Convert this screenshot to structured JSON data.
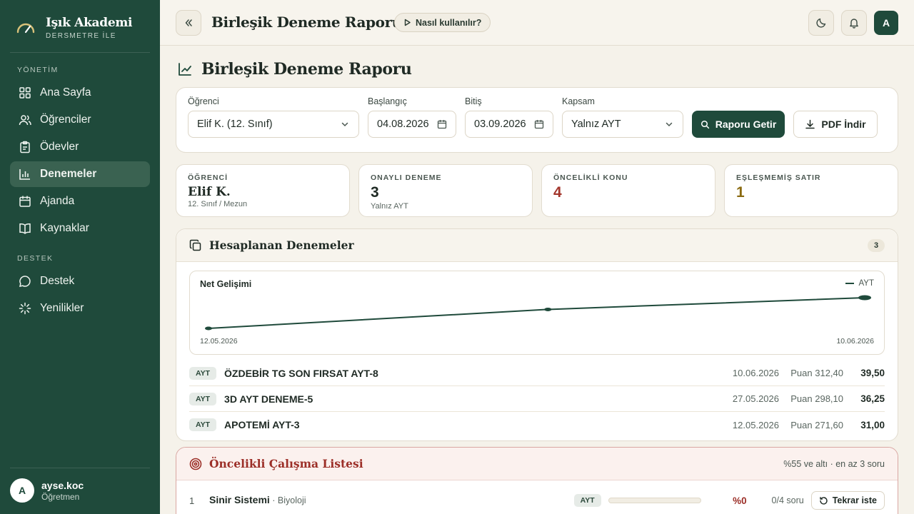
{
  "brand": {
    "name": "Işık Akademi",
    "sub": "DERSMETRE İLE"
  },
  "sidebar": {
    "section_admin": "YÖNETİM",
    "section_support": "DESTEK",
    "items": [
      {
        "label": "Ana Sayfa"
      },
      {
        "label": "Öğrenciler"
      },
      {
        "label": "Ödevler"
      },
      {
        "label": "Denemeler"
      },
      {
        "label": "Ajanda"
      },
      {
        "label": "Kaynaklar"
      },
      {
        "label": "Destek"
      },
      {
        "label": "Yenilikler"
      }
    ],
    "active": "Denemeler"
  },
  "user": {
    "initial": "A",
    "name": "ayse.koc",
    "role": "Öğretmen"
  },
  "topbar": {
    "title": "Birleşik Deneme Raporu",
    "help": "Nasıl kullanılır?",
    "avatar": "A"
  },
  "page": {
    "title": "Birleşik Deneme Raporu"
  },
  "filters": {
    "student_label": "Öğrenci",
    "student_value": "Elif K. (12. Sınıf)",
    "start_label": "Başlangıç",
    "start_value": "04.08.2026",
    "end_label": "Bitiş",
    "end_value": "03.09.2026",
    "scope_label": "Kapsam",
    "scope_value": "Yalnız AYT",
    "fetch_label": "Raporu Getir",
    "pdf_label": "PDF İndir"
  },
  "stats": [
    {
      "label": "ÖĞRENCİ",
      "value": "Elif K.",
      "sub": "12. Sınıf / Mezun",
      "color": "#1f2a24"
    },
    {
      "label": "ONAYLI DENEME",
      "value": "3",
      "sub": "Yalnız AYT",
      "color": "#1f2a24"
    },
    {
      "label": "ÖNCELİKLİ KONU",
      "value": "4",
      "sub": "",
      "color": "#a3362c"
    },
    {
      "label": "EŞLEŞMEMİŞ SATIR",
      "value": "1",
      "sub": "",
      "color": "#8a6a10"
    }
  ],
  "exams_section": {
    "title": "Hesaplanan Denemeler",
    "count": "3"
  },
  "chart_data": {
    "type": "line",
    "title": "Net Gelişimi",
    "series": [
      {
        "name": "AYT",
        "color": "#1f4a3b",
        "x": [
          "12.05.2026",
          "27.05.2026",
          "10.06.2026"
        ],
        "y": [
          31.0,
          36.25,
          39.5
        ]
      }
    ],
    "x_tick_labels": [
      "12.05.2026",
      "10.06.2026"
    ],
    "grid": false,
    "legend": "top-right"
  },
  "exams": [
    {
      "tag": "AYT",
      "name": "ÖZDEBİR TG SON FIRSAT AYT-8",
      "date": "10.06.2026",
      "score": "Puan 312,40",
      "net": "39,50"
    },
    {
      "tag": "AYT",
      "name": "3D AYT DENEME-5",
      "date": "27.05.2026",
      "score": "Puan 298,10",
      "net": "36,25"
    },
    {
      "tag": "AYT",
      "name": "APOTEMİ AYT-3",
      "date": "12.05.2026",
      "score": "Puan 271,60",
      "net": "31,00"
    }
  ],
  "priority": {
    "title": "Öncelikli Çalışma Listesi",
    "note": "%55 ve altı · en az 3 soru",
    "rows": [
      {
        "idx": "1",
        "topic": "Sinir Sistemi",
        "subject": " · Biyoloji",
        "tag": "AYT",
        "pct_fill": 0,
        "pct": "%0",
        "questions": "0/4 soru",
        "retry": "Tekrar iste"
      }
    ]
  }
}
